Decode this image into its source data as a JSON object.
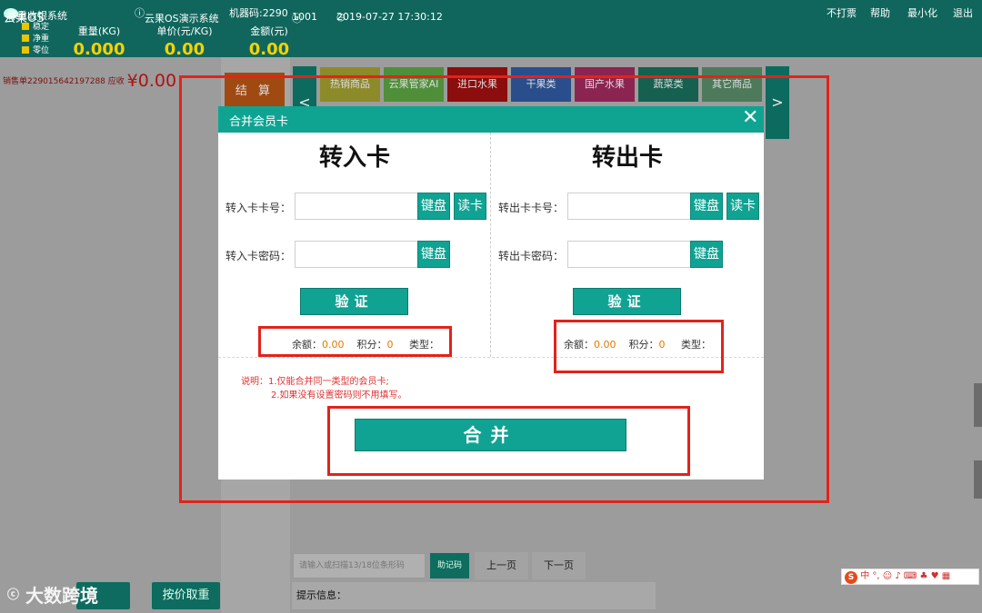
{
  "topbar": {
    "brand": "云果OS",
    "system_name": "称重收银系统",
    "demo_system": "云果OS演示系统",
    "machine_code": "机器码:2290",
    "user": "1001",
    "datetime": "2019-07-27 17:30:12",
    "actions": [
      "不打票",
      "帮助",
      "最小化",
      "退出"
    ],
    "flags": [
      "稳定",
      "净重",
      "零位"
    ],
    "weight_label": "重量(KG)",
    "weight_value": "0.000",
    "unit_price_label": "单价(元/KG)",
    "unit_price_value": "0.00",
    "amount_label": "金额(元)",
    "amount_value": "0.00"
  },
  "order": {
    "number": "销售单229015642197288",
    "due_label": "应收",
    "due_value": "¥0.00"
  },
  "settle_label": "结 算",
  "nav_prev": "<",
  "nav_next": ">",
  "categories": [
    "热销商品",
    "云果管家AI",
    "进口水果",
    "干果类",
    "国产水果",
    "蔬菜类",
    "其它商品"
  ],
  "category_colors": [
    "#8d8a2a",
    "#4f8f3a",
    "#8c0d0d",
    "#2a4e8c",
    "#8c2452",
    "#15604f",
    "#4d7a5a"
  ],
  "search": {
    "placeholder": "请输入或扫描13/18位条形码",
    "tag_button": "助记码",
    "prev_page": "上一页",
    "next_page": "下一页",
    "hint_label": "提示信息："
  },
  "bottom_left": {
    "watermark": "大数跨境",
    "price_button": "按价取重"
  },
  "ime_text": "中 °, ☺ ♪ ⌨ ♣ ♥ ▦",
  "modal": {
    "title": "合并会员卡",
    "close": "✕",
    "in_card": {
      "heading": "转入卡",
      "card_no_label": "转入卡卡号：",
      "pwd_label": "转入卡密码：",
      "keyboard": "键盘",
      "read_card": "读卡",
      "verify": "验证",
      "balance_label": "余额：",
      "balance": "0.00",
      "points_label": "积分：",
      "points": "0",
      "type_label": "类型："
    },
    "out_card": {
      "heading": "转出卡",
      "card_no_label": "转出卡卡号：",
      "pwd_label": "转出卡密码：",
      "keyboard": "键盘",
      "read_card": "读卡",
      "verify": "验证",
      "balance_label": "余额：",
      "balance": "0.00",
      "points_label": "积分：",
      "points": "0",
      "type_label": "类型："
    },
    "note_line1": "说明：1.仅能合并同一类型的会员卡;",
    "note_line2": "2.如果没有设置密码则不用填写。",
    "merge": "合并"
  }
}
